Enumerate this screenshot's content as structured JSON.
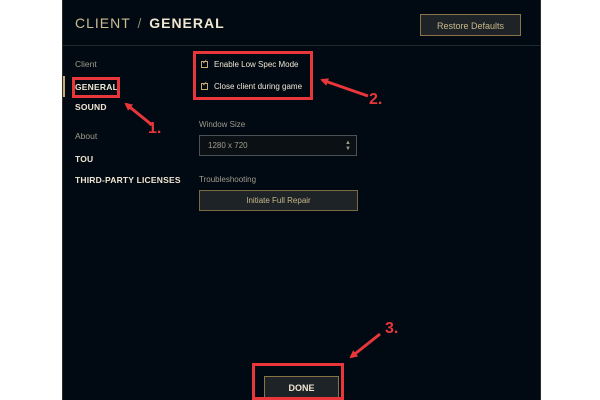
{
  "window": {
    "title_section": "CLIENT",
    "title_separator": "/",
    "title_page": "GENERAL",
    "restore_defaults_label": "Restore Defaults"
  },
  "nav": {
    "items": [
      {
        "label": "Client"
      },
      {
        "label": "GENERAL"
      },
      {
        "label": "SOUND"
      },
      {
        "label": "About"
      },
      {
        "label": "TOU"
      },
      {
        "label": "THIRD-PARTY LICENSES"
      }
    ]
  },
  "settings": {
    "low_spec_label": "Enable Low Spec Mode",
    "low_spec_checked": true,
    "close_client_label": "Close client during game",
    "close_client_checked": true,
    "window_size_label": "Window Size",
    "window_size_value": "1280 x 720",
    "troubleshooting_label": "Troubleshooting",
    "repair_button_label": "Initiate Full Repair"
  },
  "footer": {
    "done_label": "DONE"
  },
  "annotations": {
    "step1": "1.",
    "step2": "2.",
    "step3": "3."
  },
  "colors": {
    "background": "#010a13",
    "gold": "#c8aa6e",
    "annotation_red": "#e8363a"
  }
}
